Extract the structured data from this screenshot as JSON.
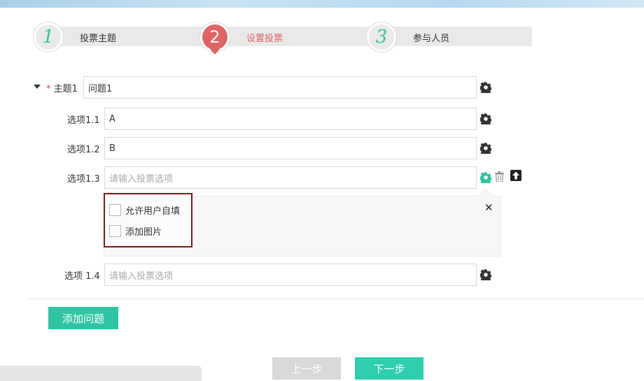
{
  "steps": [
    {
      "number": "1",
      "label": "投票主题"
    },
    {
      "number": "2",
      "label": "设置投票"
    },
    {
      "number": "3",
      "label": "参与人员"
    }
  ],
  "topic": {
    "required_mark": "*",
    "label": "主题1",
    "value": "问题1"
  },
  "options": [
    {
      "label": "选项1.1",
      "value": "A",
      "placeholder": ""
    },
    {
      "label": "选项1.2",
      "value": "B",
      "placeholder": ""
    },
    {
      "label": "选项1.3",
      "value": "",
      "placeholder": "请输入投票选项"
    },
    {
      "label": "选项 1.4",
      "value": "",
      "placeholder": "请输入投票选项"
    }
  ],
  "option_settings": {
    "allow_custom_label": "允许用户自填",
    "add_image_label": "添加图片",
    "close_glyph": "✕"
  },
  "buttons": {
    "add_question": "添加问题",
    "prev": "上一步",
    "next": "下一步"
  },
  "colors": {
    "accent": "#2dc4a4",
    "active_step": "#e06464",
    "highlight_border": "#7a1a1a"
  }
}
